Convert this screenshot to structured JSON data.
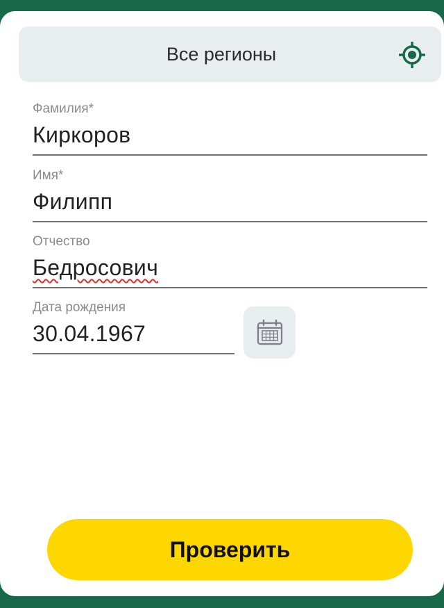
{
  "region": {
    "label": "Все регионы",
    "icon": "locate-icon"
  },
  "form": {
    "surname": {
      "label": "Фамилия*",
      "value": "Киркоров"
    },
    "name": {
      "label": "Имя*",
      "value": "Филипп"
    },
    "patronymic": {
      "label": "Отчество",
      "value": "Бедросович"
    },
    "birthdate": {
      "label": "Дата рождения",
      "value": "30.04.1967",
      "icon": "calendar-icon"
    }
  },
  "actions": {
    "check_label": "Проверить"
  },
  "colors": {
    "frame": "#18694a",
    "accent": "#18694a",
    "button": "#fed700",
    "panel": "#e8edf0"
  }
}
